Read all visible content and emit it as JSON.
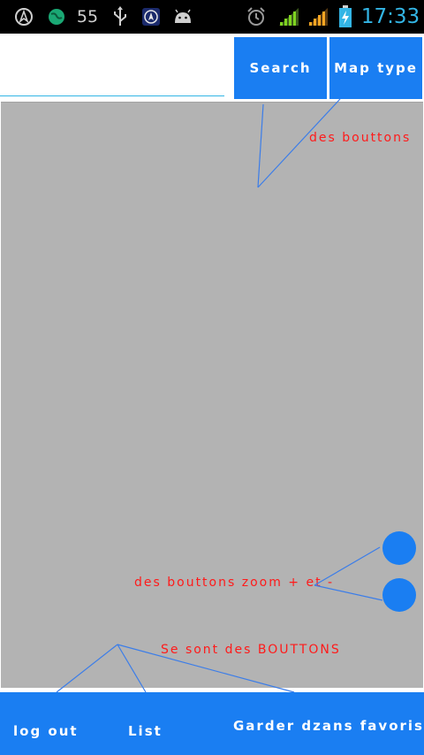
{
  "status_bar": {
    "icons": [
      "navigation-arrow-icon",
      "globe-icon",
      "usb-icon",
      "navigation-app-icon",
      "android-icon",
      "alarm-icon",
      "signal-icon",
      "signal-icon-2",
      "battery-charging-icon"
    ],
    "notification_count": "55",
    "time": "17:33"
  },
  "toolbar": {
    "search_placeholder": "",
    "search_label": "Search",
    "map_type_label": "Map type"
  },
  "annotations": {
    "top_buttons": "des bouttons",
    "zoom_buttons": "des bouttons zoom + et -",
    "bottom_buttons": "Se sont des  BOUTTONS"
  },
  "bottom_bar": {
    "logout_label": "log out",
    "list_label": "List",
    "favorites_label": "Garder dzans favoris"
  },
  "colors": {
    "accent_blue": "#1a7ef2",
    "map_gray": "#b3b3b3",
    "annotation_red": "#ff1a1a",
    "line_blue": "#3b7de9",
    "clock_blue": "#33b5e5"
  }
}
